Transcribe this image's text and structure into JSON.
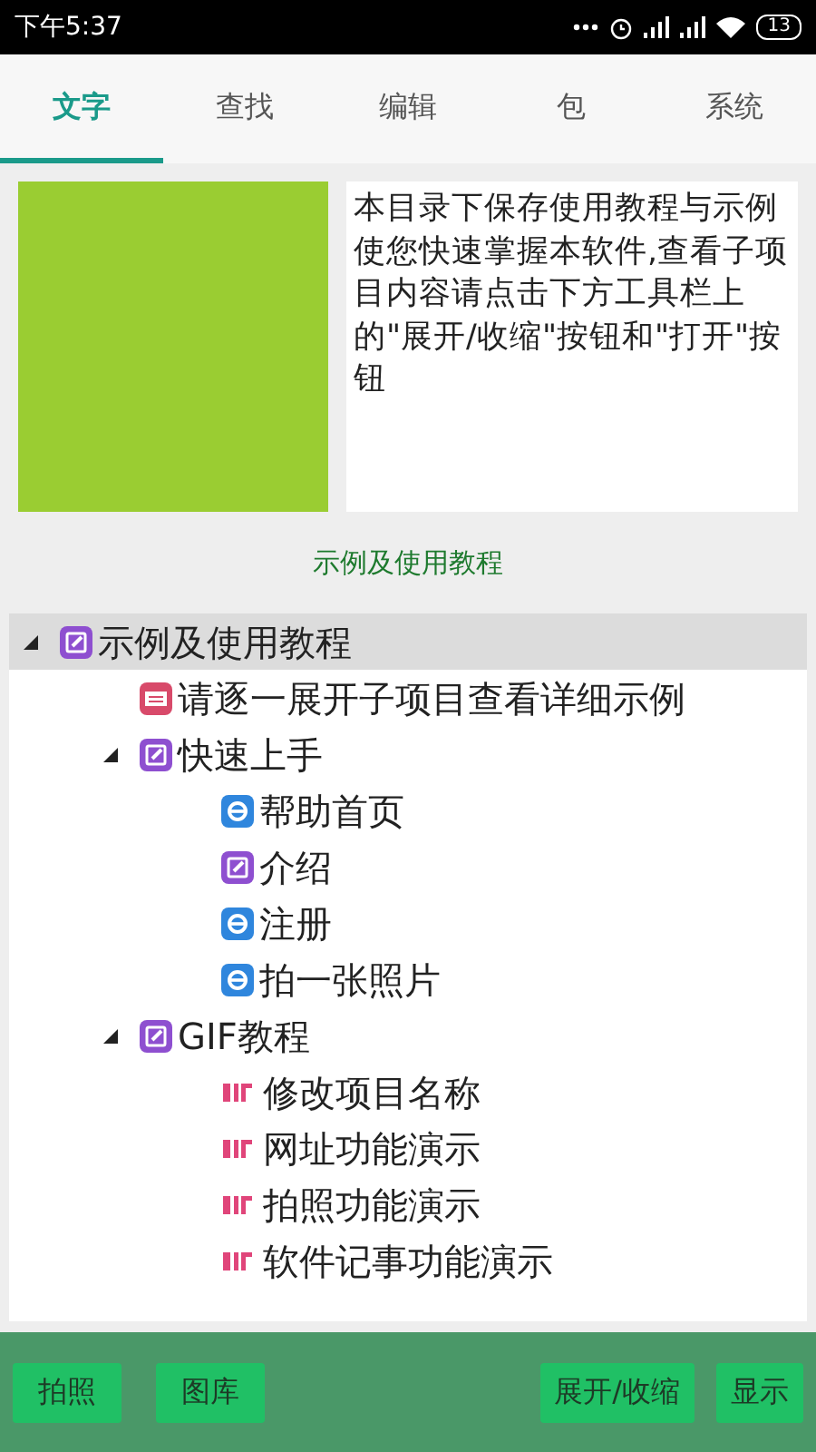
{
  "status_bar": {
    "time": "下午5:37",
    "battery": "13"
  },
  "tabs": [
    {
      "label": "文字",
      "selected": true
    },
    {
      "label": "查找",
      "selected": false
    },
    {
      "label": "编辑",
      "selected": false
    },
    {
      "label": "包",
      "selected": false
    },
    {
      "label": "系统",
      "selected": false
    }
  ],
  "preview": {
    "description": "本目录下保存使用教程与示例使您快速掌握本软件,查看子项目内容请点击下方工具栏上的\"展开/收缩\"按钮和\"打开\"按钮",
    "caption": "示例及使用教程"
  },
  "tree": [
    {
      "label": "示例及使用教程",
      "kind": "note",
      "expanded": true,
      "selected": true,
      "children": [
        {
          "label": "请逐一展开子项目查看详细示例",
          "kind": "book",
          "selected": false
        },
        {
          "label": "快速上手",
          "kind": "note",
          "expanded": true,
          "selected": false,
          "children": [
            {
              "label": "帮助首页",
              "kind": "web",
              "selected": false
            },
            {
              "label": "介绍",
              "kind": "note",
              "selected": false
            },
            {
              "label": "注册",
              "kind": "web",
              "selected": false
            },
            {
              "label": "拍一张照片",
              "kind": "web",
              "selected": false
            }
          ]
        },
        {
          "label": "GIF教程",
          "kind": "note",
          "expanded": true,
          "selected": false,
          "children": [
            {
              "label": "修改项目名称",
              "kind": "gif",
              "selected": false
            },
            {
              "label": "网址功能演示",
              "kind": "gif",
              "selected": false
            },
            {
              "label": "拍照功能演示",
              "kind": "gif",
              "selected": false
            },
            {
              "label": "软件记事功能演示",
              "kind": "gif",
              "selected": false
            }
          ]
        }
      ]
    }
  ],
  "toolbar": {
    "left": [
      "拍照",
      "图库"
    ],
    "right": [
      "展开/收缩",
      "显示"
    ]
  }
}
